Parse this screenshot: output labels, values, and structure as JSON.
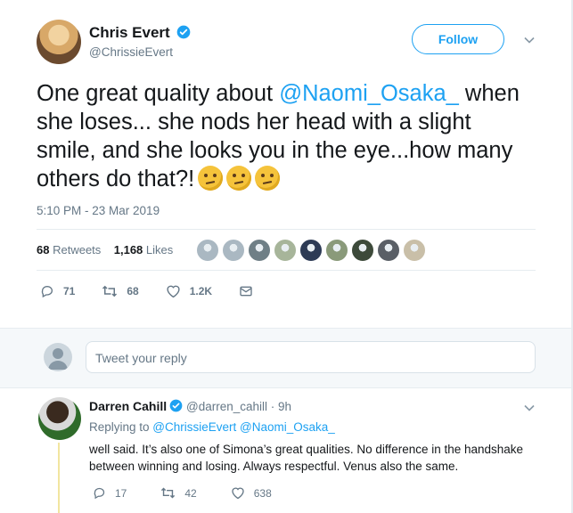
{
  "tweet": {
    "author_name": "Chris Evert",
    "author_handle": "@ChrissieEvert",
    "follow_label": "Follow",
    "text_before": "One great quality about ",
    "mention": "@Naomi_Osaka_",
    "text_after": " when she loses... she nods her head with a slight smile, and she looks you in the eye...how many others do that?!",
    "emoji_icon": "thinking-face-icon",
    "timestamp": "5:10 PM - 23 Mar 2019",
    "retweets_count": "68",
    "retweets_label": "Retweets",
    "likes_count": "1,168",
    "likes_label": "Likes",
    "liker_colors": [
      "#aab8c2",
      "#aab8c2",
      "#6f7f86",
      "#a7b59a",
      "#2d3b55",
      "#8a9a7a",
      "#3d4a3a",
      "#5a5f66",
      "#c9bfa8"
    ],
    "actions": {
      "reply_count": "71",
      "retweet_count": "68",
      "like_count": "1.2K"
    }
  },
  "reply_box": {
    "placeholder": "Tweet your reply"
  },
  "reply": {
    "author_name": "Darren Cahill",
    "author_handle": "@darren_cahill · 9h",
    "replying_prefix": "Replying to ",
    "replying_to": "@ChrissieEvert @Naomi_Osaka_",
    "text": "well said. It’s also one of Simona’s great qualities. No difference in the handshake between winning and losing. Always respectful. Venus also the same.",
    "actions": {
      "reply_count": "17",
      "retweet_count": "42",
      "like_count": "638"
    }
  },
  "colors": {
    "accent": "#1da1f2",
    "muted": "#657786",
    "text": "#14171a"
  }
}
